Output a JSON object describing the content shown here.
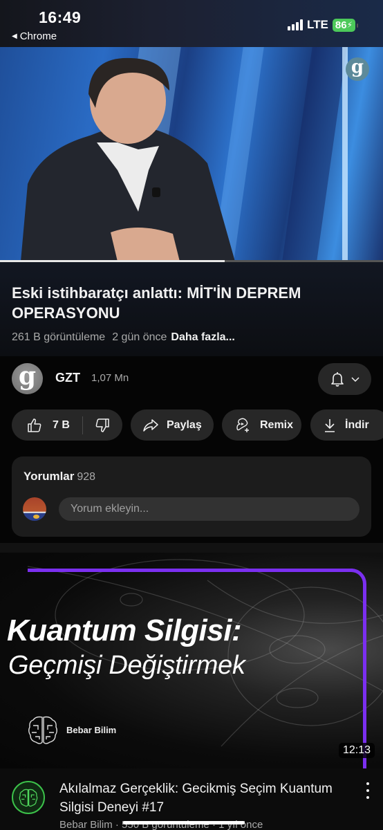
{
  "status_bar": {
    "time": "16:49",
    "back_app": "Chrome",
    "network": "LTE",
    "battery": "86",
    "battery_color": "#4cc95a"
  },
  "player": {
    "channel_watermark": "g",
    "progress_fraction": 0.587
  },
  "video": {
    "title": "Eski istihbaratçı anlattı: MİT'İN DEPREM OPERASYONU",
    "views": "261 B görüntüleme",
    "age": "2 gün önce",
    "more_label": "Daha fazla..."
  },
  "channel": {
    "avatar_letter": "g",
    "name": "GZT",
    "subscribers": "1,07 Mn",
    "bell_icon": "bell-icon",
    "dropdown_icon": "chevron-down-icon"
  },
  "actions": {
    "like_count": "7 B",
    "share_label": "Paylaş",
    "remix_label": "Remix",
    "download_label": "İndir"
  },
  "comments": {
    "title": "Yorumlar",
    "count": "928",
    "input_placeholder": "Yorum ekleyin..."
  },
  "next_video": {
    "thumbnail_title_line1": "Kuantum Silgisi:",
    "thumbnail_title_line2": "Geçmişi Değiştirmek",
    "thumbnail_brand": "Bebar Bilim",
    "accent_color": "#7b2ff0",
    "duration": "12:13",
    "title": "Akılalmaz Gerçeklik: Gecikmiş Seçim Kuantum Silgisi Deneyi #17",
    "meta": "Bebar Bilim · 550 B görüntüleme · 1 yıl önce"
  }
}
